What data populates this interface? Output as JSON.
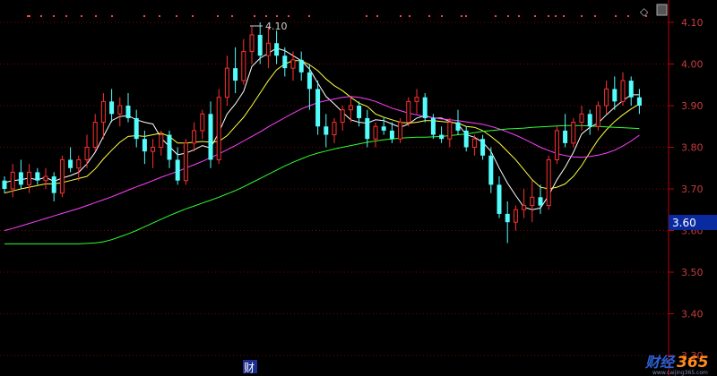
{
  "chart_data": {
    "type": "candlestick",
    "ylim": [
      3.3,
      4.13
    ],
    "y_ticks": [
      "4.10",
      "4.00",
      "3.90",
      "3.80",
      "3.70",
      "3.60",
      "3.50",
      "3.40",
      "3.30"
    ],
    "current_price": "3.60",
    "high_marker": "4.10",
    "finance_marker": "财",
    "up_color": "#ff3030",
    "down_color": "#54fcfc",
    "grid": true,
    "candles": [
      [
        3.72,
        3.73,
        3.69,
        3.7
      ],
      [
        3.7,
        3.76,
        3.68,
        3.74
      ],
      [
        3.74,
        3.77,
        3.7,
        3.71
      ],
      [
        3.71,
        3.76,
        3.69,
        3.74
      ],
      [
        3.74,
        3.75,
        3.71,
        3.72
      ],
      [
        3.72,
        3.75,
        3.7,
        3.73
      ],
      [
        3.73,
        3.74,
        3.67,
        3.69
      ],
      [
        3.69,
        3.78,
        3.68,
        3.77
      ],
      [
        3.77,
        3.8,
        3.74,
        3.75
      ],
      [
        3.75,
        3.78,
        3.72,
        3.77
      ],
      [
        3.77,
        3.83,
        3.75,
        3.8
      ],
      [
        3.8,
        3.88,
        3.79,
        3.86
      ],
      [
        3.86,
        3.93,
        3.82,
        3.91
      ],
      [
        3.91,
        3.94,
        3.86,
        3.88
      ],
      [
        3.88,
        3.92,
        3.85,
        3.9
      ],
      [
        3.9,
        3.93,
        3.86,
        3.87
      ],
      [
        3.87,
        3.89,
        3.8,
        3.82
      ],
      [
        3.82,
        3.84,
        3.76,
        3.79
      ],
      [
        3.79,
        3.82,
        3.75,
        3.8
      ],
      [
        3.8,
        3.84,
        3.78,
        3.83
      ],
      [
        3.83,
        3.84,
        3.75,
        3.77
      ],
      [
        3.77,
        3.8,
        3.71,
        3.72
      ],
      [
        3.72,
        3.82,
        3.71,
        3.81
      ],
      [
        3.81,
        3.86,
        3.79,
        3.84
      ],
      [
        3.84,
        3.89,
        3.82,
        3.88
      ],
      [
        3.88,
        3.91,
        3.75,
        3.77
      ],
      [
        3.77,
        3.94,
        3.76,
        3.92
      ],
      [
        3.92,
        4.02,
        3.9,
        3.99
      ],
      [
        3.99,
        4.04,
        3.93,
        3.96
      ],
      [
        3.96,
        4.06,
        3.95,
        4.03
      ],
      [
        4.03,
        4.09,
        4.0,
        4.07
      ],
      [
        4.07,
        4.1,
        4.0,
        4.02
      ],
      [
        4.02,
        4.09,
        3.99,
        4.05
      ],
      [
        4.05,
        4.08,
        4.0,
        4.02
      ],
      [
        4.02,
        4.04,
        3.97,
        3.99
      ],
      [
        3.99,
        4.03,
        3.96,
        4.01
      ],
      [
        4.01,
        4.03,
        3.96,
        3.98
      ],
      [
        3.98,
        4.0,
        3.89,
        3.94
      ],
      [
        3.94,
        3.96,
        3.83,
        3.85
      ],
      [
        3.85,
        3.88,
        3.8,
        3.83
      ],
      [
        3.83,
        3.87,
        3.81,
        3.86
      ],
      [
        3.86,
        3.9,
        3.84,
        3.89
      ],
      [
        3.89,
        3.92,
        3.86,
        3.9
      ],
      [
        3.9,
        3.91,
        3.85,
        3.87
      ],
      [
        3.87,
        3.89,
        3.8,
        3.82
      ],
      [
        3.82,
        3.86,
        3.8,
        3.85
      ],
      [
        3.85,
        3.87,
        3.83,
        3.84
      ],
      [
        3.84,
        3.86,
        3.81,
        3.82
      ],
      [
        3.82,
        3.87,
        3.81,
        3.86
      ],
      [
        3.86,
        3.92,
        3.85,
        3.91
      ],
      [
        3.91,
        3.94,
        3.88,
        3.92
      ],
      [
        3.92,
        3.93,
        3.86,
        3.87
      ],
      [
        3.87,
        3.88,
        3.82,
        3.83
      ],
      [
        3.83,
        3.85,
        3.81,
        3.82
      ],
      [
        3.82,
        3.87,
        3.8,
        3.86
      ],
      [
        3.86,
        3.89,
        3.83,
        3.84
      ],
      [
        3.84,
        3.85,
        3.79,
        3.8
      ],
      [
        3.8,
        3.83,
        3.78,
        3.82
      ],
      [
        3.82,
        3.83,
        3.77,
        3.78
      ],
      [
        3.78,
        3.8,
        3.69,
        3.71
      ],
      [
        3.71,
        3.73,
        3.63,
        3.64
      ],
      [
        3.64,
        3.67,
        3.57,
        3.62
      ],
      [
        3.62,
        3.66,
        3.6,
        3.65
      ],
      [
        3.65,
        3.7,
        3.63,
        3.66
      ],
      [
        3.66,
        3.72,
        3.62,
        3.68
      ],
      [
        3.68,
        3.71,
        3.64,
        3.66
      ],
      [
        3.66,
        3.78,
        3.65,
        3.77
      ],
      [
        3.77,
        3.85,
        3.76,
        3.84
      ],
      [
        3.84,
        3.88,
        3.8,
        3.81
      ],
      [
        3.81,
        3.87,
        3.8,
        3.86
      ],
      [
        3.86,
        3.9,
        3.84,
        3.88
      ],
      [
        3.88,
        3.89,
        3.83,
        3.85
      ],
      [
        3.85,
        3.91,
        3.84,
        3.9
      ],
      [
        3.9,
        3.96,
        3.88,
        3.94
      ],
      [
        3.94,
        3.97,
        3.89,
        3.91
      ],
      [
        3.91,
        3.98,
        3.9,
        3.96
      ],
      [
        3.96,
        3.97,
        3.9,
        3.92
      ],
      [
        3.92,
        3.94,
        3.88,
        3.9
      ]
    ],
    "ma": [
      {
        "color": "#ffffff",
        "values": [
          3.715,
          3.72,
          3.722,
          3.726,
          3.722,
          3.728,
          3.718,
          3.726,
          3.732,
          3.74,
          3.76,
          3.788,
          3.826,
          3.864,
          3.874,
          3.876,
          3.866,
          3.86,
          3.856,
          3.822,
          3.802,
          3.782,
          3.786,
          3.794,
          3.804,
          3.798,
          3.836,
          3.88,
          3.904,
          3.934,
          3.994,
          4.014,
          4.026,
          4.038,
          4.032,
          4.02,
          4.008,
          3.988,
          3.954,
          3.922,
          3.904,
          3.884,
          3.866,
          3.86,
          3.858,
          3.866,
          3.864,
          3.856,
          3.848,
          3.856,
          3.87,
          3.876,
          3.87,
          3.87,
          3.862,
          3.856,
          3.83,
          3.824,
          3.812,
          3.79,
          3.75,
          3.714,
          3.684,
          3.656,
          3.65,
          3.654,
          3.684,
          3.722,
          3.752,
          3.788,
          3.832,
          3.848,
          3.858,
          3.878,
          3.896,
          3.912,
          3.926,
          3.926
        ]
      },
      {
        "color": "#ffff40",
        "values": [
          3.69,
          3.695,
          3.7,
          3.704,
          3.708,
          3.712,
          3.712,
          3.715,
          3.72,
          3.725,
          3.73,
          3.748,
          3.772,
          3.793,
          3.812,
          3.826,
          3.828,
          3.826,
          3.83,
          3.834,
          3.826,
          3.81,
          3.81,
          3.812,
          3.814,
          3.812,
          3.814,
          3.828,
          3.85,
          3.872,
          3.9,
          3.93,
          3.96,
          3.986,
          4.0,
          4.008,
          4.008,
          3.998,
          3.984,
          3.964,
          3.948,
          3.936,
          3.92,
          3.906,
          3.898,
          3.88,
          3.872,
          3.866,
          3.86,
          3.858,
          3.86,
          3.864,
          3.864,
          3.862,
          3.86,
          3.858,
          3.85,
          3.848,
          3.84,
          3.826,
          3.81,
          3.79,
          3.77,
          3.746,
          3.722,
          3.704,
          3.7,
          3.704,
          3.712,
          3.73,
          3.756,
          3.788,
          3.818,
          3.842,
          3.862,
          3.878,
          3.892,
          3.904
        ]
      },
      {
        "color": "#ff40ff",
        "values": [
          3.6,
          3.605,
          3.611,
          3.617,
          3.623,
          3.629,
          3.635,
          3.641,
          3.647,
          3.653,
          3.66,
          3.667,
          3.674,
          3.681,
          3.689,
          3.697,
          3.705,
          3.712,
          3.72,
          3.728,
          3.735,
          3.742,
          3.75,
          3.758,
          3.766,
          3.775,
          3.784,
          3.794,
          3.804,
          3.815,
          3.826,
          3.837,
          3.849,
          3.86,
          3.871,
          3.882,
          3.892,
          3.9,
          3.907,
          3.912,
          3.916,
          3.92,
          3.922,
          3.92,
          3.916,
          3.91,
          3.902,
          3.894,
          3.888,
          3.882,
          3.878,
          3.874,
          3.871,
          3.868,
          3.866,
          3.864,
          3.861,
          3.858,
          3.855,
          3.85,
          3.844,
          3.837,
          3.829,
          3.82,
          3.81,
          3.8,
          3.792,
          3.785,
          3.78,
          3.777,
          3.776,
          3.778,
          3.781,
          3.786,
          3.793,
          3.803,
          3.815,
          3.829
        ]
      },
      {
        "color": "#30ff30",
        "values": [
          3.568,
          3.568,
          3.568,
          3.568,
          3.568,
          3.568,
          3.568,
          3.568,
          3.568,
          3.568,
          3.569,
          3.57,
          3.573,
          3.578,
          3.585,
          3.592,
          3.6,
          3.609,
          3.618,
          3.627,
          3.636,
          3.644,
          3.652,
          3.659,
          3.666,
          3.673,
          3.68,
          3.688,
          3.696,
          3.705,
          3.715,
          3.725,
          3.735,
          3.745,
          3.755,
          3.764,
          3.772,
          3.78,
          3.786,
          3.791,
          3.796,
          3.8,
          3.804,
          3.808,
          3.812,
          3.815,
          3.818,
          3.82,
          3.822,
          3.823,
          3.824,
          3.824,
          3.825,
          3.826,
          3.828,
          3.83,
          3.832,
          3.835,
          3.838,
          3.84,
          3.842,
          3.844,
          3.845,
          3.846,
          3.848,
          3.849,
          3.85,
          3.851,
          3.852,
          3.852,
          3.852,
          3.851,
          3.85,
          3.849,
          3.848,
          3.847,
          3.846,
          3.845
        ]
      }
    ]
  },
  "watermark": {
    "logo_text_1": "财经",
    "logo_text_2": "365",
    "sub_text": "www.caijing365.com"
  },
  "marker_symbol": "◇"
}
